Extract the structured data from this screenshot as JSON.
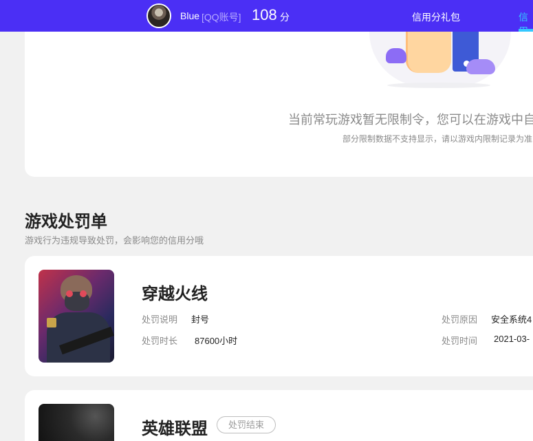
{
  "header": {
    "user_name": "Blue",
    "account_type": "[QQ账号]",
    "score": "108",
    "score_unit": "分",
    "nav_gift": "信用分礼包",
    "nav_active": "信用"
  },
  "limit_card": {
    "message": "当前常玩游戏暂无限制令，您可以在游戏中自",
    "note": "部分限制数据不支持显示，请以游戏内限制记录为准"
  },
  "penalty_section": {
    "title": "游戏处罚单",
    "subtitle": "游戏行为违规导致处罚，会影响您的信用分哦"
  },
  "penalties": [
    {
      "game": "穿越火线",
      "thumb_icon": "crossfire-soldier-icon",
      "fields": {
        "desc_label": "处罚说明",
        "desc_value": "封号",
        "duration_label": "处罚时长",
        "duration_value": "87600小时",
        "reason_label": "处罚原因",
        "reason_value": "安全系统4",
        "time_label": "处罚时间",
        "time_value": "2021-03-"
      }
    },
    {
      "game": "英雄联盟",
      "thumb_icon": "league-of-legends-icon",
      "status": "处罚结束"
    }
  ],
  "colors": {
    "header_bg": "#4b2ff5",
    "nav_active": "#34c8ff",
    "page_bg": "#f1f1f1"
  }
}
